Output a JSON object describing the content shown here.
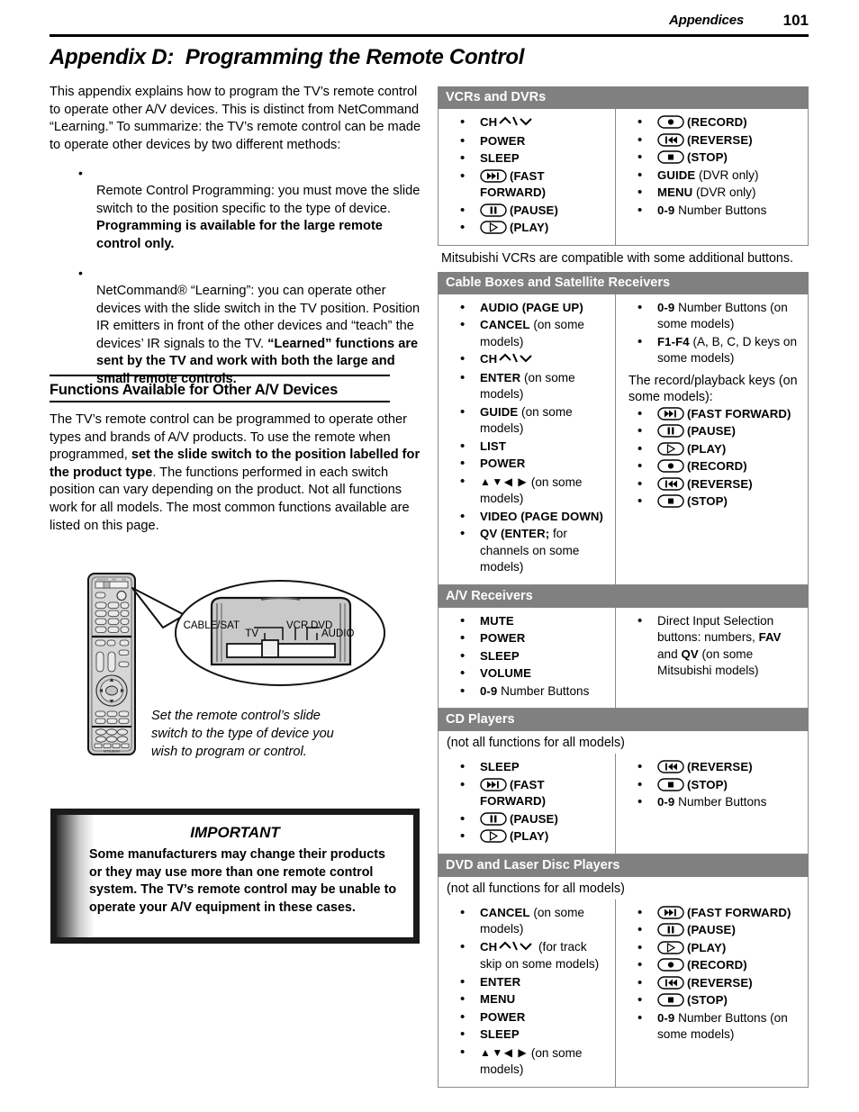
{
  "header": {
    "section": "Appendices",
    "page_number": "101"
  },
  "title": "Appendix D:  Programming the Remote Control",
  "left": {
    "intro": "This appendix explains how to program the TV’s remote control to operate other A/V devices.  This is distinct from NetCommand “Learning.”  To summarize:  the TV’s remote control can be made to operate other devices by two different methods:",
    "bullets": [
      {
        "text_plain": "Remote Control Programming:  you must move the slide switch to the position specific to the type of device.  ",
        "text_bold": "Programming is available for the large remote control only."
      },
      {
        "text_plain": "NetCommand® “Learning”:  you can operate other devices with the slide switch in the TV position.  Position IR emitters in front of the other devices and “teach” the  devices’ IR signals to the TV.  ",
        "text_bold": "“Learned” functions are sent by the TV and work with both the large and small remote controls."
      }
    ],
    "section_heading": "Functions Available for Other A/V Devices",
    "section_para_1": "The TV’s remote control can be programmed to operate other types and brands of A/V products.  To use the remote when programmed, ",
    "section_para_bold_1": "set the slide switch to the position labelled for the product type",
    "section_para_2": ".  The functions performed in each switch position can vary depending on the product.  Not all functions work for all models.  The most common functions available are listed on this page."
  },
  "figure": {
    "slide_labels": {
      "cable_sat": "CABLE/SAT",
      "tv": "TV",
      "vcr": "VCR",
      "dvd": "DVD",
      "audio": "AUDIO"
    },
    "brand": "MITSUBISHI",
    "caption": "Set the remote control’s slide switch to the type of device you wish to program or control."
  },
  "important": {
    "title": "IMPORTANT",
    "body": "Some manufacturers may change their products or they may use more than one remote control system.  The TV’s remote control may be unable to operate your A/V equipment in these cases."
  },
  "tables": [
    {
      "id": "vcrs-and-dvrs",
      "heading": "VCRs and DVRs",
      "left_items": [
        {
          "cmd": "CH",
          "chev": true
        },
        {
          "cmd": "POWER"
        },
        {
          "cmd": "SLEEP"
        },
        {
          "icon": "fast-forward",
          "cmd": "(FAST FORWARD)"
        },
        {
          "icon": "pause",
          "cmd": "(PAUSE)"
        },
        {
          "icon": "play",
          "cmd": "(PLAY)"
        }
      ],
      "right_items": [
        {
          "icon": "record",
          "cmd": "(RECORD)"
        },
        {
          "icon": "reverse",
          "cmd": "(REVERSE)"
        },
        {
          "icon": "stop",
          "cmd": "(STOP)"
        },
        {
          "cmd": "GUIDE",
          "rest": " (DVR only)"
        },
        {
          "cmd": "MENU",
          "rest": " (DVR only)"
        },
        {
          "cmd": "0-9",
          "rest": " Number Buttons"
        }
      ],
      "note_below": "Mitsubishi VCRs are compatible with some additional buttons."
    },
    {
      "id": "cable-boxes-and-satellite-receivers",
      "heading": "Cable Boxes and Satellite Receivers",
      "left_items": [
        {
          "cmd": "AUDIO (PAGE UP)"
        },
        {
          "cmd": "CANCEL",
          "rest": " (on some models)"
        },
        {
          "cmd": "CH",
          "chev": true
        },
        {
          "cmd": "ENTER",
          "rest": " (on some models)"
        },
        {
          "cmd": "GUIDE",
          "rest": " (on some models)"
        },
        {
          "cmd": "LIST"
        },
        {
          "cmd": "POWER"
        },
        {
          "arrows": true,
          "rest": " (on some models)"
        },
        {
          "cmd": "VIDEO (PAGE DOWN)"
        },
        {
          "cmd": "QV (ENTER;",
          "rest": " for channels on some models)"
        }
      ],
      "right_items": [
        {
          "cmd": "0-9",
          "rest": " Number Buttons (on some models)"
        },
        {
          "cmd": "F1-F4",
          "rest": " (A, B, C, D keys on some models)"
        }
      ],
      "right_note": "The record/playback keys (on some models):",
      "right_items2": [
        {
          "icon": "fast-forward",
          "cmd": "(FAST FORWARD)"
        },
        {
          "icon": "pause",
          "cmd": "(PAUSE)"
        },
        {
          "icon": "play",
          "cmd": "(PLAY)"
        },
        {
          "icon": "record",
          "cmd": "(RECORD)"
        },
        {
          "icon": "reverse",
          "cmd": "(REVERSE)"
        },
        {
          "icon": "stop",
          "cmd": "(STOP)"
        }
      ]
    },
    {
      "id": "av-receivers",
      "heading": "A/V Receivers",
      "left_items": [
        {
          "cmd": "MUTE"
        },
        {
          "cmd": "POWER"
        },
        {
          "cmd": "SLEEP"
        },
        {
          "cmd": "VOLUME"
        },
        {
          "cmd": "0-9",
          "rest": " Number Buttons"
        }
      ],
      "right_items": [
        {
          "rest_first": "Direct Input Selection buttons:  numbers, ",
          "cmd": "FAV",
          "mid": " and ",
          "cmd2": "QV",
          "rest": " (on some Mitsubishi models)"
        }
      ]
    },
    {
      "id": "cd-players",
      "heading": "CD Players",
      "subnote": "(not all functions for all models)",
      "left_items": [
        {
          "cmd": "SLEEP"
        },
        {
          "icon": "fast-forward",
          "cmd": "(FAST FORWARD)"
        },
        {
          "icon": "pause",
          "cmd": "(PAUSE)"
        },
        {
          "icon": "play",
          "cmd": "(PLAY)"
        }
      ],
      "right_items": [
        {
          "icon": "reverse",
          "cmd": "(REVERSE)"
        },
        {
          "icon": "stop",
          "cmd": "(STOP)"
        },
        {
          "cmd": "0-9",
          "rest": " Number Buttons"
        }
      ]
    },
    {
      "id": "dvd-and-laser-disc-players",
      "heading": "DVD and Laser Disc Players",
      "subnote": "(not all functions for all models)",
      "left_items": [
        {
          "cmd": "CANCEL",
          "rest": " (on some models)"
        },
        {
          "cmd": "CH",
          "chev": true,
          "rest": " (for track skip on some models)"
        },
        {
          "cmd": "ENTER"
        },
        {
          "cmd": "MENU"
        },
        {
          "cmd": "POWER"
        },
        {
          "cmd": "SLEEP"
        },
        {
          "arrows": true,
          "rest": " (on some models)"
        }
      ],
      "right_items": [
        {
          "icon": "fast-forward",
          "cmd": "(FAST FORWARD)"
        },
        {
          "icon": "pause",
          "cmd": "(PAUSE)"
        },
        {
          "icon": "play",
          "cmd": "(PLAY)"
        },
        {
          "icon": "record",
          "cmd": "(RECORD)"
        },
        {
          "icon": "reverse",
          "cmd": "(REVERSE)"
        },
        {
          "icon": "stop",
          "cmd": "(STOP)"
        },
        {
          "cmd": "0-9",
          "rest": " Number Buttons (on some models)"
        }
      ]
    }
  ],
  "colors": {
    "table_header_bg": "#808080",
    "table_border": "#8a8a8a",
    "text": "#000000",
    "remote_body": "#c9c9c9"
  }
}
